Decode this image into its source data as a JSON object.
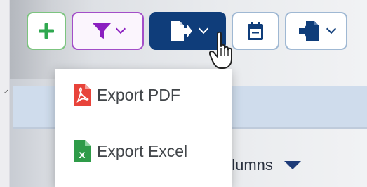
{
  "toolbar": {
    "add_button": {
      "icon": "plus-icon",
      "color": "#2fa84f"
    },
    "filter_button": {
      "icon": "filter-icon",
      "color": "#8b1fc0"
    },
    "export_button": {
      "icon": "export-file-icon",
      "color": "#0f3d7a",
      "state": "open"
    },
    "calendar_button": {
      "icon": "calendar-icon"
    },
    "import_button": {
      "icon": "import-file-icon"
    }
  },
  "export_menu": {
    "items": [
      {
        "label": "Export PDF",
        "icon": "pdf-file-icon",
        "color": "#e8433a"
      },
      {
        "label": "Export Excel",
        "icon": "excel-file-icon",
        "color": "#2e9b48"
      }
    ]
  },
  "table": {
    "columns_button_label": "olumns"
  },
  "colors": {
    "primary": "#0f3d7a",
    "accent_purple": "#8b1fc0",
    "accent_green": "#2fa84f"
  }
}
